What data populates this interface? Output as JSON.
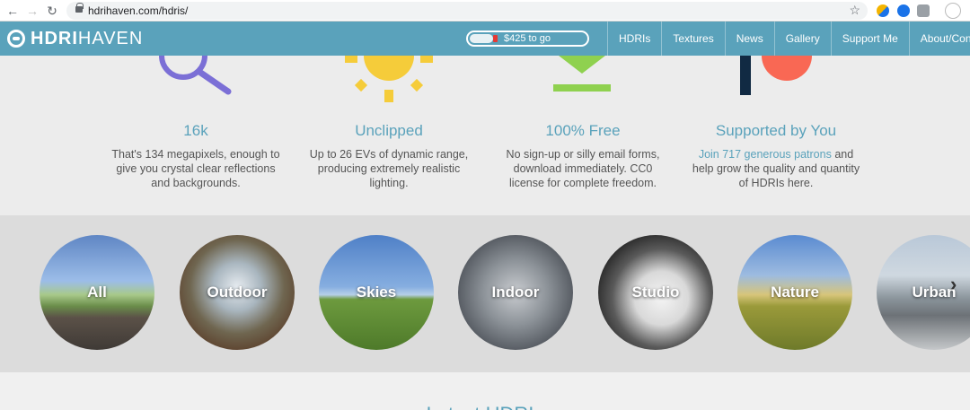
{
  "browser": {
    "url": "hdrihaven.com/hdris/"
  },
  "header": {
    "logo_bold": "HDRI",
    "logo_thin": "HAVEN",
    "goal_text": "$425 to go",
    "goal_progress": 0.2,
    "nav": [
      "HDRIs",
      "Textures",
      "News",
      "Gallery",
      "Support Me",
      "About/Contact"
    ]
  },
  "features": [
    {
      "title": "16k",
      "lines": [
        "That's 134 megapixels, enough to",
        "give you crystal clear reflections",
        "and backgrounds."
      ]
    },
    {
      "title": "Unclipped",
      "lines": [
        "Up to 26 EVs of dynamic range,",
        "producing extremely realistic",
        "lighting."
      ]
    },
    {
      "title": "100% Free",
      "lines": [
        "No sign-up or silly email forms,",
        "download immediately. CC0",
        "license for complete freedom."
      ]
    },
    {
      "title": "Supported by You",
      "link": "Join 717 generous patrons",
      "link_tail": " and",
      "lines": [
        "help grow the quality and quantity",
        "of HDRIs here."
      ]
    }
  ],
  "categories": [
    "All",
    "Outdoor",
    "Skies",
    "Indoor",
    "Studio",
    "Nature",
    "Urban"
  ],
  "latest": {
    "title": "Latest HDRIs"
  },
  "colors": {
    "brand": "#5aa2bb",
    "goal_marker": "#e53935"
  }
}
